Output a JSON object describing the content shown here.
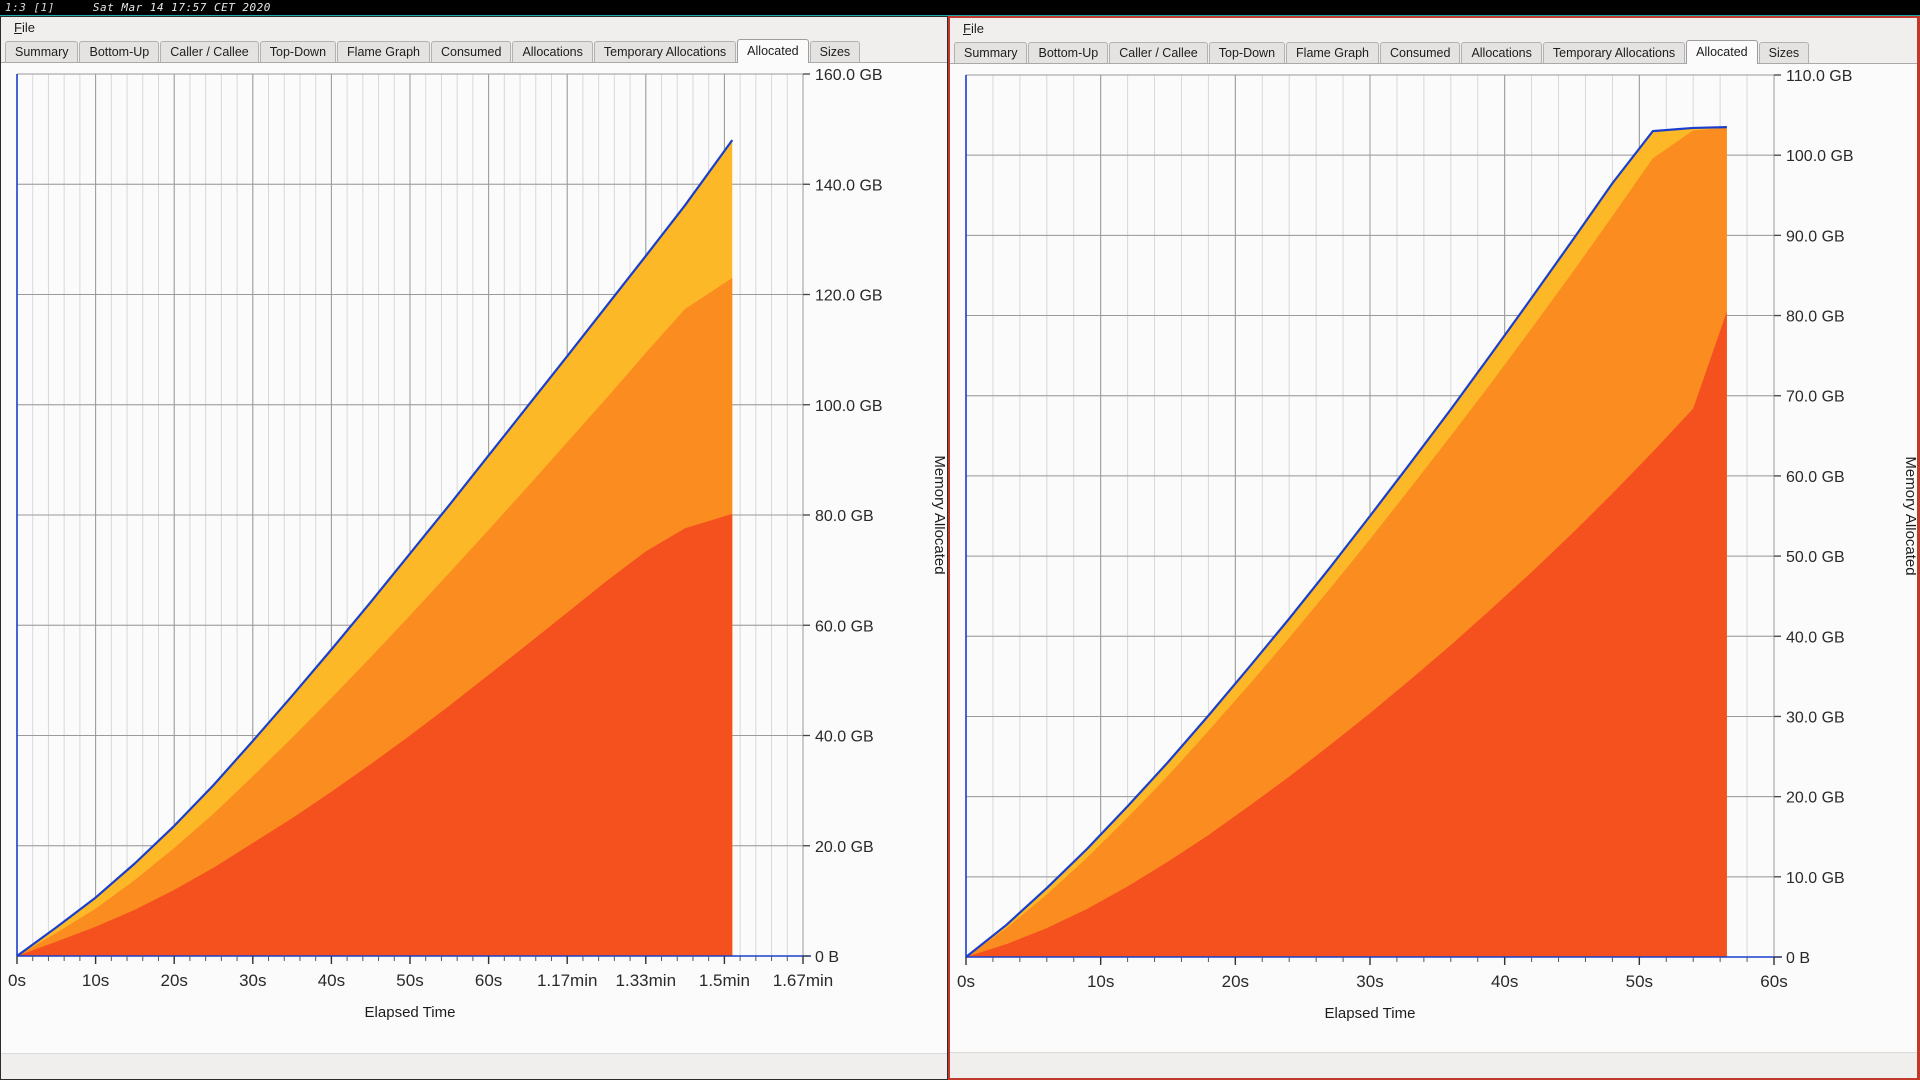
{
  "window_manager": {
    "workspace_tag": "1:3 [1]",
    "clock": "Sat Mar 14 17:57 CET 2020"
  },
  "panels": [
    {
      "id": "left",
      "focused": false,
      "menu": {
        "file_label": "File",
        "file_mnemonic": "F",
        "file_rest": "ile"
      },
      "tabs": [
        {
          "label": "Summary",
          "active": false
        },
        {
          "label": "Bottom-Up",
          "active": false
        },
        {
          "label": "Caller / Callee",
          "active": false
        },
        {
          "label": "Top-Down",
          "active": false
        },
        {
          "label": "Flame Graph",
          "active": false
        },
        {
          "label": "Consumed",
          "active": false
        },
        {
          "label": "Allocations",
          "active": false
        },
        {
          "label": "Temporary Allocations",
          "active": false
        },
        {
          "label": "Allocated",
          "active": true
        },
        {
          "label": "Sizes",
          "active": false
        }
      ],
      "chart_data": {
        "type": "area",
        "stacked": true,
        "title": "",
        "xlabel": "Elapsed Time",
        "ylabel": "Memory Allocated",
        "xtick_labels": [
          "0s",
          "10s",
          "20s",
          "30s",
          "40s",
          "50s",
          "60s",
          "1.17min",
          "1.33min",
          "1.5min",
          "1.67min"
        ],
        "xtick_values": [
          0,
          10,
          20,
          30,
          40,
          50,
          60,
          70,
          80,
          90,
          100
        ],
        "ytick_labels": [
          "0 B",
          "20.0 GB",
          "40.0 GB",
          "60.0 GB",
          "80.0 GB",
          "100.0 GB",
          "120.0 GB",
          "140.0 GB",
          "160.0 GB"
        ],
        "ytick_values": [
          0,
          20,
          40,
          60,
          80,
          100,
          120,
          140,
          160
        ],
        "xlim": [
          0,
          100
        ],
        "ylim": [
          0,
          160
        ],
        "grid": true,
        "data_extent_x": 91,
        "axis_label_side": "right",
        "colors": {
          "series_bottom": "#f4511e",
          "series_middle": "#fb8c20",
          "series_top": "#fdb827",
          "outline": "#1a3fcc",
          "grid_major": "#9a9a9a",
          "grid_minor": "#d8d8d8",
          "background": "#fbfbfb"
        },
        "x": [
          0,
          5,
          10,
          15,
          20,
          25,
          30,
          35,
          40,
          45,
          50,
          55,
          60,
          65,
          70,
          75,
          80,
          85,
          91
        ],
        "series": [
          {
            "name": "series-bottom",
            "values": [
              0,
              2.6,
              5.3,
              8.4,
              12.0,
              16.0,
              20.5,
              25.0,
              29.8,
              34.8,
              40.0,
              45.4,
              51.0,
              56.6,
              62.3,
              68.0,
              73.4,
              77.6,
              80.2
            ]
          },
          {
            "name": "series-middle",
            "values": [
              0,
              4.2,
              8.6,
              13.8,
              19.6,
              25.8,
              32.6,
              39.6,
              46.8,
              54.2,
              61.8,
              69.5,
              77.3,
              85.2,
              93.2,
              101.2,
              109.4,
              117.4,
              123.0
            ]
          },
          {
            "name": "series-top",
            "values": [
              0,
              5.2,
              10.6,
              16.8,
              23.6,
              31.0,
              39.0,
              47.2,
              55.6,
              64.2,
              73.0,
              81.8,
              90.8,
              99.8,
              108.8,
              117.9,
              127.0,
              136.2,
              148.0
            ]
          }
        ]
      }
    },
    {
      "id": "right",
      "focused": true,
      "menu": {
        "file_label": "File",
        "file_mnemonic": "F",
        "file_rest": "ile"
      },
      "tabs": [
        {
          "label": "Summary",
          "active": false
        },
        {
          "label": "Bottom-Up",
          "active": false
        },
        {
          "label": "Caller / Callee",
          "active": false
        },
        {
          "label": "Top-Down",
          "active": false
        },
        {
          "label": "Flame Graph",
          "active": false
        },
        {
          "label": "Consumed",
          "active": false
        },
        {
          "label": "Allocations",
          "active": false
        },
        {
          "label": "Temporary Allocations",
          "active": false
        },
        {
          "label": "Allocated",
          "active": true
        },
        {
          "label": "Sizes",
          "active": false
        }
      ],
      "chart_data": {
        "type": "area",
        "stacked": true,
        "title": "",
        "xlabel": "Elapsed Time",
        "ylabel": "Memory Allocated",
        "xtick_labels": [
          "0s",
          "10s",
          "20s",
          "30s",
          "40s",
          "50s",
          "60s"
        ],
        "xtick_values": [
          0,
          10,
          20,
          30,
          40,
          50,
          60
        ],
        "ytick_labels": [
          "0 B",
          "10.0 GB",
          "20.0 GB",
          "30.0 GB",
          "40.0 GB",
          "50.0 GB",
          "60.0 GB",
          "70.0 GB",
          "80.0 GB",
          "90.0 GB",
          "100.0 GB",
          "110.0 GB"
        ],
        "ytick_values": [
          0,
          10,
          20,
          30,
          40,
          50,
          60,
          70,
          80,
          90,
          100,
          110
        ],
        "xlim": [
          0,
          60
        ],
        "ylim": [
          0,
          110
        ],
        "grid": true,
        "data_extent_x": 56.5,
        "axis_label_side": "right",
        "colors": {
          "series_bottom": "#f4511e",
          "series_middle": "#fb8c20",
          "series_top": "#fdb827",
          "outline": "#1a3fcc",
          "grid_major": "#9a9a9a",
          "grid_minor": "#d8d8d8",
          "background": "#fbfbfb"
        },
        "x": [
          0,
          3,
          6,
          9,
          12,
          15,
          18,
          21,
          24,
          27,
          30,
          33,
          36,
          39,
          42,
          45,
          48,
          51,
          54,
          56.5
        ],
        "series": [
          {
            "name": "series-bottom",
            "values": [
              0,
              1.6,
              3.6,
              6.0,
              8.8,
              11.9,
              15.2,
              18.8,
              22.5,
              26.4,
              30.4,
              34.6,
              38.9,
              43.4,
              48.0,
              52.8,
              57.8,
              63.0,
              68.4,
              80.5
            ]
          },
          {
            "name": "series-middle",
            "values": [
              0,
              3.6,
              7.8,
              12.4,
              17.4,
              22.6,
              28.2,
              33.9,
              39.8,
              45.9,
              52.1,
              58.5,
              65.0,
              71.6,
              78.4,
              85.3,
              92.4,
              99.6,
              103.1,
              103.4
            ]
          },
          {
            "name": "series-top",
            "values": [
              0,
              4.0,
              8.6,
              13.5,
              18.8,
              24.3,
              30.1,
              36.1,
              42.2,
              48.5,
              55.0,
              61.6,
              68.3,
              75.2,
              82.2,
              89.3,
              96.5,
              103.0,
              103.4,
              103.5
            ]
          }
        ]
      }
    }
  ]
}
